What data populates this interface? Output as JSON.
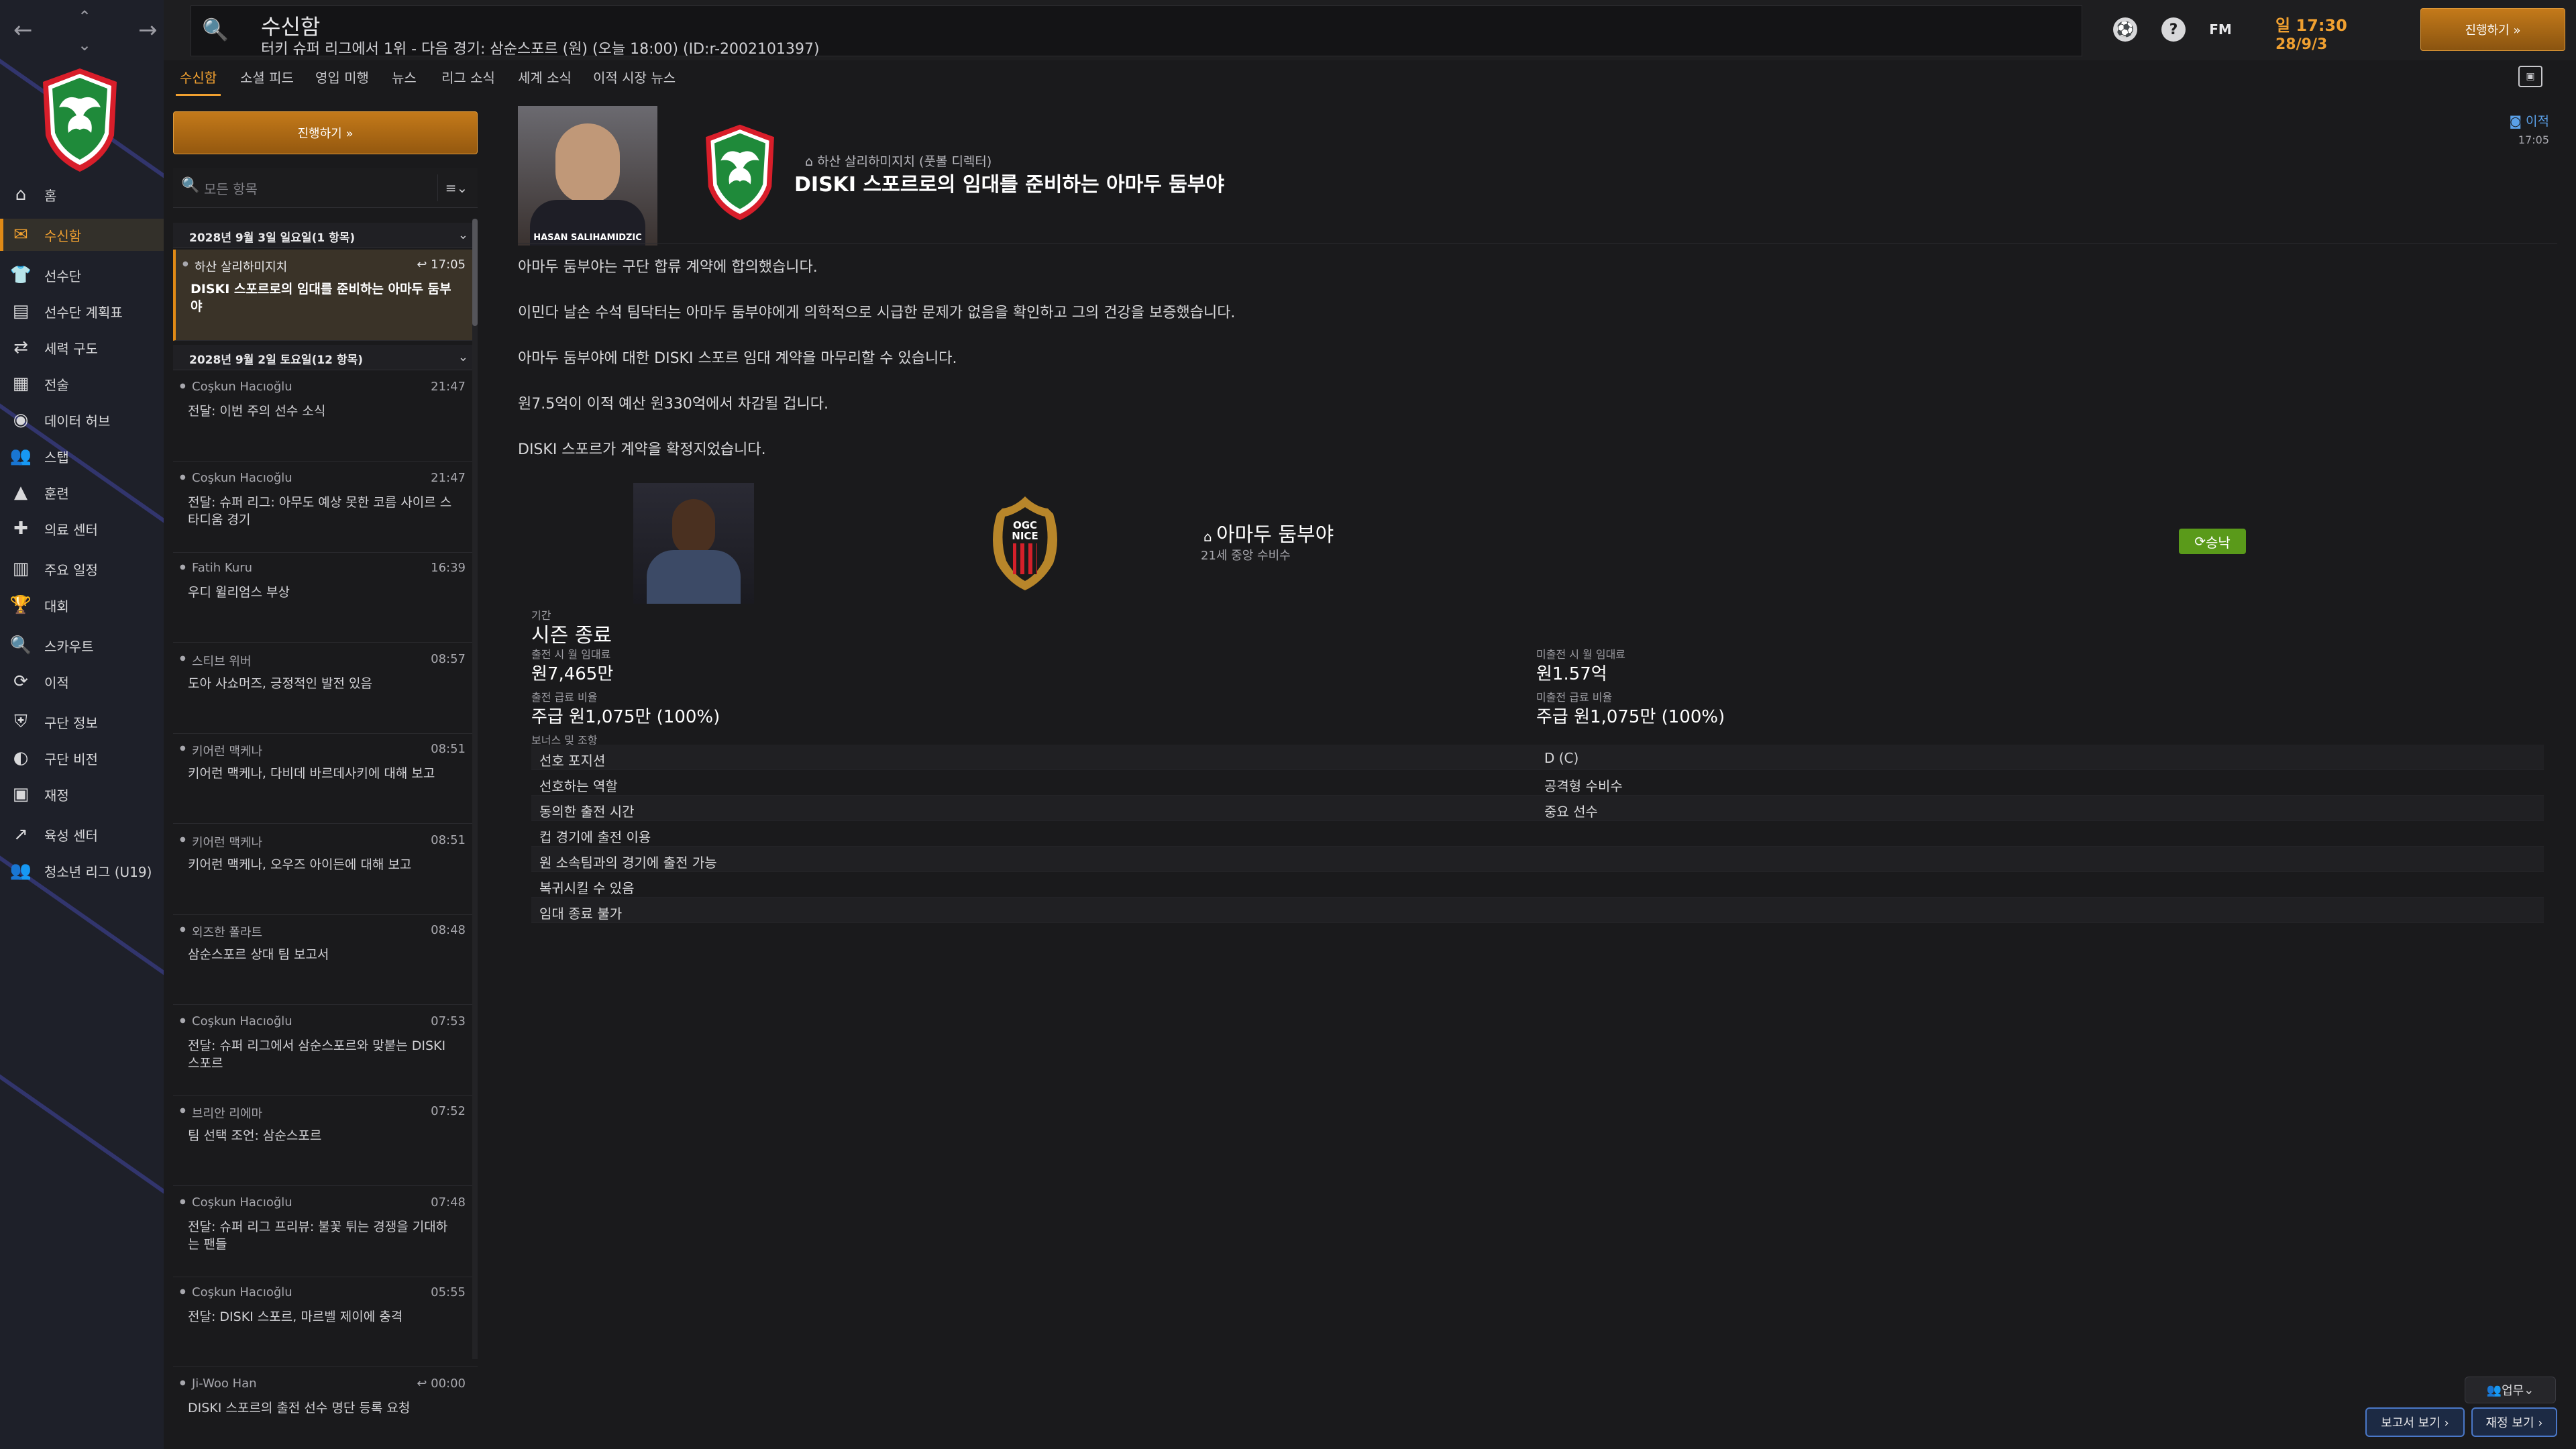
{
  "window": {
    "title": "수신함",
    "subtitle": "터키 슈퍼 리그에서 1위 - 다음 경기: 삼순스포르 (원) (오늘 18:00) (ID:r-2002101397)",
    "fm_label": "FM",
    "time": "일 17:30",
    "date": "28/9/3",
    "continue_label": "진행하기 »"
  },
  "sidebar": {
    "items": [
      {
        "icon": "home-icon",
        "glyph": "⌂",
        "label": "홈"
      },
      {
        "icon": "inbox-icon",
        "glyph": "✉",
        "label": "수신함"
      },
      {
        "icon": "squad-icon",
        "glyph": "👕",
        "label": "선수단"
      },
      {
        "icon": "squad-plan-icon",
        "glyph": "▤",
        "label": "선수단 계획표"
      },
      {
        "icon": "dynamics-icon",
        "glyph": "⇄",
        "label": "세력 구도"
      },
      {
        "icon": "tactics-icon",
        "glyph": "▦",
        "label": "전술"
      },
      {
        "icon": "data-hub-icon",
        "glyph": "◉",
        "label": "데이터 허브"
      },
      {
        "icon": "staff-icon",
        "glyph": "👥",
        "label": "스탭"
      },
      {
        "icon": "training-icon",
        "glyph": "▲",
        "label": "훈련"
      },
      {
        "icon": "medical-icon",
        "glyph": "✚",
        "label": "의료 센터"
      },
      {
        "icon": "schedule-icon",
        "glyph": "▥",
        "label": "주요 일정"
      },
      {
        "icon": "competitions-icon",
        "glyph": "🏆",
        "label": "대회"
      },
      {
        "icon": "scouting-icon",
        "glyph": "🔍",
        "label": "스카우트"
      },
      {
        "icon": "transfers-icon",
        "glyph": "⟳",
        "label": "이적"
      },
      {
        "icon": "club-info-icon",
        "glyph": "⛨",
        "label": "구단 정보"
      },
      {
        "icon": "club-vision-icon",
        "glyph": "◐",
        "label": "구단 비전"
      },
      {
        "icon": "finances-icon",
        "glyph": "▣",
        "label": "재정"
      },
      {
        "icon": "development-icon",
        "glyph": "↗",
        "label": "육성 센터"
      },
      {
        "icon": "youth-league-icon",
        "glyph": "👥",
        "label": "청소년 리그 (U19)"
      }
    ],
    "active_index": 1
  },
  "tabs": [
    "수신함",
    "소셜 피드",
    "영입 미행",
    "뉴스",
    "리그 소식",
    "세계 소식",
    "이적 시장 뉴스"
  ],
  "list": {
    "continue_label": "진행하기 »",
    "search_placeholder": "모든 항목",
    "groups": [
      {
        "title": "2028년 9월 3일 일요일(1 항목)"
      },
      {
        "title": "2028년 9월 2일 토요일(12 항목)"
      }
    ],
    "messages": [
      {
        "from": "하산 살리하미지치",
        "time": "↩ 17:05",
        "subject": "DISKI 스포르로의 임대를 준비하는 아마두 둠부야"
      },
      {
        "from": "Coşkun Hacıoğlu",
        "time": "21:47",
        "subject": "전달: 이번 주의 선수 소식"
      },
      {
        "from": "Coşkun Hacıoğlu",
        "time": "21:47",
        "subject": "전달: 슈퍼 리그: 아무도 예상 못한 코름 사이르 스타디움 경기"
      },
      {
        "from": "Fatih Kuru",
        "time": "16:39",
        "subject": "우디 윌리엄스 부상"
      },
      {
        "from": "스티브 위버",
        "time": "08:57",
        "subject": "도아 사쇼머즈, 긍정적인 발전 있음"
      },
      {
        "from": "키어런 맥케나",
        "time": "08:51",
        "subject": "키어런 맥케나, 다비데 바르데사키에 대해 보고"
      },
      {
        "from": "키어런 맥케나",
        "time": "08:51",
        "subject": "키어런 맥케나, 오우즈 아이든에 대해 보고"
      },
      {
        "from": "외즈한 폴라트",
        "time": "08:48",
        "subject": "삼순스포르 상대 팀 보고서"
      },
      {
        "from": "Coşkun Hacıoğlu",
        "time": "07:53",
        "subject": "전달: 슈퍼 리그에서 삼순스포르와 맞붙는 DISKI 스포르"
      },
      {
        "from": "브리안 리에마",
        "time": "07:52",
        "subject": "팀 선택 조언: 삼순스포르"
      },
      {
        "from": "Coşkun Hacıoğlu",
        "time": "07:48",
        "subject": "전달: 슈퍼 리그 프리뷰: 불꽃 튀는 경쟁을 기대하는 팬들"
      },
      {
        "from": "Coşkun Hacıoğlu",
        "time": "05:55",
        "subject": "전달: DISKI 스포르, 마르벨 제이에 충격"
      },
      {
        "from": "Ji-Woo Han",
        "time": "↩ 00:00",
        "subject": "DISKI 스포르의 출전 선수 명단 등록 요청"
      }
    ]
  },
  "message": {
    "author_caption": "HASAN SALIHAMIDZIC",
    "sender": "하산 살리하미지치 (풋볼 디렉터)",
    "headline": "DISKI 스포르로의 임대를 준비하는 아마두 둠부야",
    "status_label": "이적",
    "status_time": "17:05",
    "paragraphs": [
      "아마두 둠부야는 구단 합류 계약에 합의했습니다.",
      "이민다 날손 수석 팀닥터는 아마두 둠부야에게 의학적으로 시급한 문제가 없음을 확인하고 그의 건강을 보증했습니다.",
      "아마두 둠부야에 대한 DISKI 스포르 임대 계약을 마무리할 수 있습니다.",
      "원7.5억이 이적 예산 원330억에서 차감될 겁니다.",
      "DISKI 스포르가 계약을 확정지었습니다."
    ],
    "player_name": "아마두 둠부야",
    "player_desc": "21세 중앙 수비수",
    "club_badge_text": "OGC NICE",
    "accepted_label": "승낙",
    "period_label": "기간",
    "period_value": "시즌 종료",
    "fee_played_label": "출전 시 월 임대료",
    "fee_played_value": "원7,465만",
    "fee_unplayed_label": "미출전 시 월 임대료",
    "fee_unplayed_value": "원1.57억",
    "wage_played_label": "출전 급료 비율",
    "wage_played_value": "주급 원1,075만 (100%)",
    "wage_unplayed_label": "미출전 급료 비율",
    "wage_unplayed_value": "주급 원1,075만 (100%)",
    "clauses_label": "보너스 및 조항",
    "clauses": [
      {
        "k": "선호 포지션",
        "v": "D (C)"
      },
      {
        "k": "선호하는 역할",
        "v": "공격형 수비수"
      },
      {
        "k": "동의한 출전 시간",
        "v": "중요 선수"
      },
      {
        "k": "컵 경기에 출전 이용",
        "v": ""
      },
      {
        "k": "원 소속팀과의 경기에 출전 가능",
        "v": ""
      },
      {
        "k": "복귀시킬 수 있음",
        "v": ""
      },
      {
        "k": "임대 종료 불가",
        "v": ""
      }
    ]
  },
  "footer": {
    "job_label": "업무",
    "report_label": "보고서 보기 ›",
    "finance_label": "재정 보기 ›"
  },
  "colors": {
    "accent": "#f0a030",
    "accepted": "#5a9a1a",
    "link": "#5aa0e8"
  }
}
